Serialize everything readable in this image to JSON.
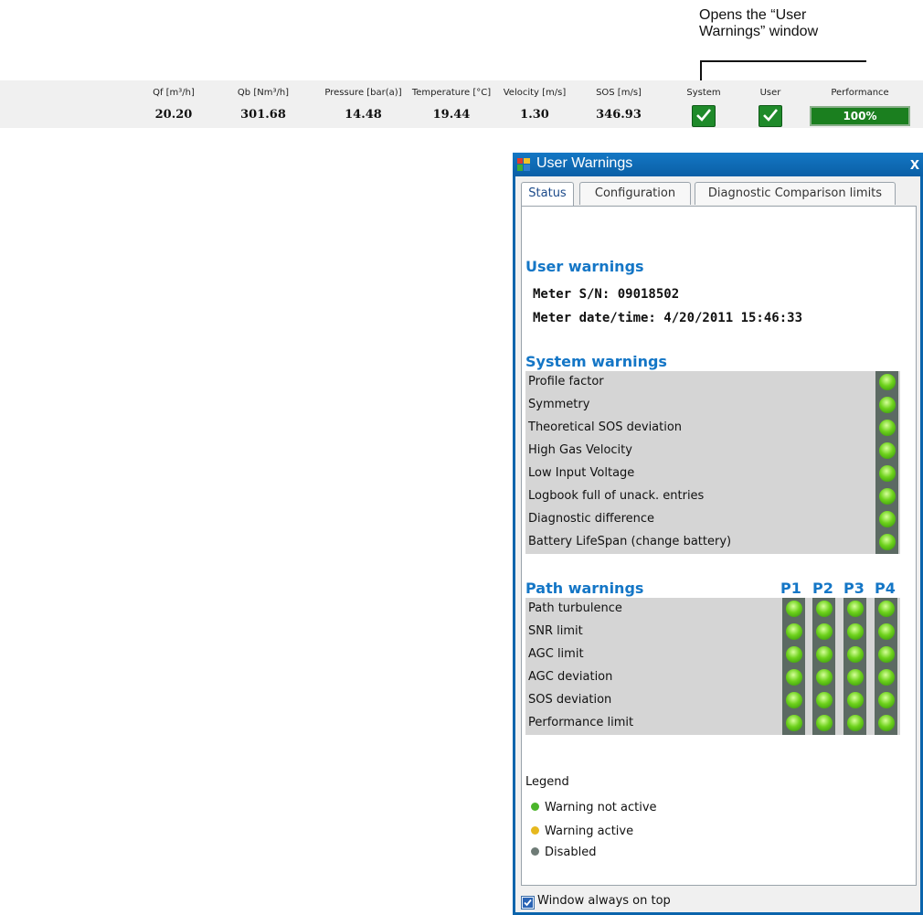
{
  "annotation": {
    "line1": "Opens the “User",
    "line2": "Warnings” window"
  },
  "measurements": {
    "columns": [
      {
        "label": "Qf [m³/h]",
        "value": "20.20"
      },
      {
        "label": "Qb [Nm³/h]",
        "value": "301.68"
      },
      {
        "label": "Pressure [bar(a)]",
        "value": "14.48"
      },
      {
        "label": "Temperature [°C]",
        "value": "19.44"
      },
      {
        "label": "Velocity [m/s]",
        "value": "1.30"
      },
      {
        "label": "SOS [m/s]",
        "value": "346.93"
      }
    ],
    "system_label": "System",
    "user_label": "User",
    "performance_label": "Performance",
    "performance_value": "100%",
    "system_status": "ok",
    "user_status": "ok",
    "performance_fraction": 1.0
  },
  "window": {
    "title": "User Warnings",
    "close_glyph": "x",
    "tabs": [
      {
        "label": "Status",
        "active": true
      },
      {
        "label": "Configuration",
        "active": false
      },
      {
        "label": "Diagnostic Comparison limits",
        "active": false
      }
    ],
    "user_warnings_title": "User warnings",
    "meter_sn": "Meter S/N: 09018502",
    "meter_datetime": "Meter date/time: 4/20/2011 15:46:33",
    "system_warnings_title": "System warnings",
    "system_warnings": [
      {
        "label": "Profile factor",
        "state": "not-active"
      },
      {
        "label": "Symmetry",
        "state": "not-active"
      },
      {
        "label": "Theoretical SOS deviation",
        "state": "not-active"
      },
      {
        "label": "High Gas Velocity",
        "state": "not-active"
      },
      {
        "label": "Low Input Voltage",
        "state": "not-active"
      },
      {
        "label": "Logbook full of unack. entries",
        "state": "not-active"
      },
      {
        "label": "Diagnostic difference",
        "state": "not-active"
      },
      {
        "label": "Battery LifeSpan (change battery)",
        "state": "not-active"
      }
    ],
    "path_warnings_title": "Path warnings",
    "path_headers": [
      "P1",
      "P2",
      "P3",
      "P4"
    ],
    "path_warnings": [
      {
        "label": "Path turbulence"
      },
      {
        "label": "SNR limit"
      },
      {
        "label": "AGC limit"
      },
      {
        "label": "AGC deviation"
      },
      {
        "label": "SOS deviation"
      },
      {
        "label": "Performance limit"
      }
    ],
    "legend_title": "Legend",
    "legend": [
      {
        "label": "Warning not active",
        "color": "#4bb52a"
      },
      {
        "label": "Warning active",
        "color": "#e6b81e"
      },
      {
        "label": "Disabled",
        "color": "#6e7b76"
      }
    ],
    "always_on_top_label": "Window always on top",
    "always_on_top_checked": true
  },
  "colors": {
    "title_bar": "#0b64ac",
    "accent_blue": "#1476c6",
    "led_green": "#6ed21c",
    "check_green": "#1f8a2a"
  }
}
